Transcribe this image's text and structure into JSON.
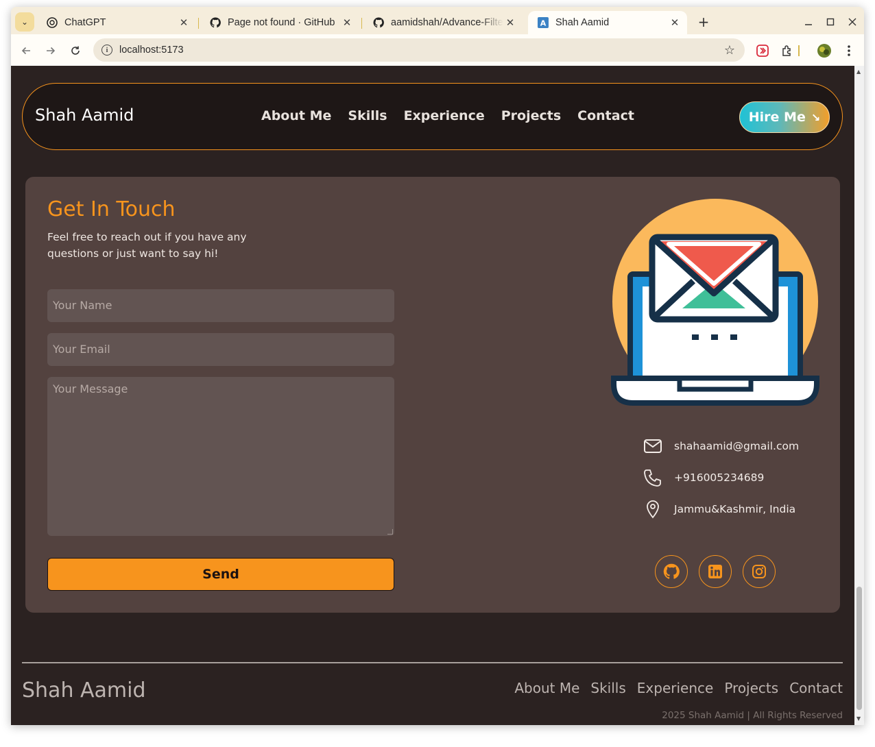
{
  "browser": {
    "tabs": [
      {
        "title": "ChatGPT",
        "icon": "chatgpt-icon"
      },
      {
        "title": "Page not found · GitHub",
        "icon": "github-icon"
      },
      {
        "title": "aamidshah/Advance-Filte",
        "icon": "github-icon"
      },
      {
        "title": "Shah Aamid",
        "icon": "app-favicon-icon"
      }
    ],
    "new_tab_label": "+",
    "url": "localhost:5173"
  },
  "site": {
    "brand": "Shah Aamid",
    "nav": [
      "About Me",
      "Skills",
      "Experience",
      "Projects",
      "Contact"
    ],
    "hire_label": "Hire Me",
    "hire_arrow": "↘"
  },
  "contact": {
    "title": "Get In Touch",
    "subtitle": "Feel free to reach out if you have any questions or just want to say hi!",
    "name_placeholder": "Your Name",
    "email_placeholder": "Your Email",
    "message_placeholder": "Your Message",
    "send_label": "Send",
    "email": "shahaamid@gmail.com",
    "phone": "+916005234689",
    "location": "Jammu&Kashmir, India",
    "socials": [
      "github-icon",
      "linkedin-icon",
      "instagram-icon"
    ],
    "accent": "#f7941d"
  },
  "footer": {
    "brand": "Shah Aamid",
    "links": [
      "About Me",
      "Skills",
      "Experience",
      "Projects",
      "Contact"
    ],
    "copyright": "2025 Shah Aamid | All Rights Reserved"
  }
}
